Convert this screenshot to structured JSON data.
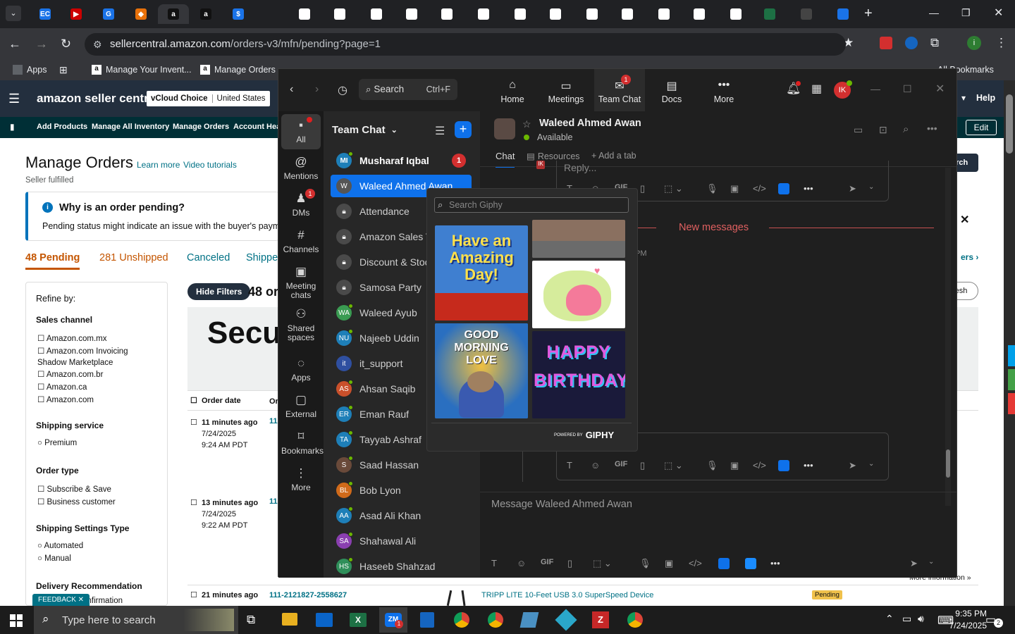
{
  "browser": {
    "url_host": "sellercentral.amazon.com",
    "url_path": "/orders-v3/mfn/pending?page=1",
    "bookmarks": [
      "Apps",
      "Manage Your Invent...",
      "Manage Orders",
      "All Bookmarks"
    ],
    "tabs": [
      {
        "icon": "EC",
        "color": "#1a73e8"
      },
      {
        "icon": "▶",
        "color": "#c00"
      },
      {
        "icon": "G",
        "color": "#1a73e8"
      },
      {
        "icon": "◆",
        "color": "#e8710a"
      },
      {
        "icon": "a",
        "color": "#111"
      },
      {
        "icon": "a",
        "color": "#111"
      },
      {
        "icon": "$",
        "color": "#1a73e8"
      }
    ]
  },
  "amazon": {
    "logo": "amazon seller central",
    "store_badge": "vCloud Choice",
    "marketplace": "United States",
    "help": "Help",
    "edit": "Edit",
    "nav": [
      "Add Products",
      "Manage All Inventory",
      "Manage Orders",
      "Account Heal"
    ],
    "page_title": "Manage Orders",
    "learn_more": "Learn more",
    "video_tutorials": "Video tutorials",
    "seller_fulfilled": "Seller fulfilled",
    "banner_title": "Why is an order pending?",
    "banner_text": "Pending status might indicate an issue with the buyer's payment m",
    "tabs": [
      "48 Pending",
      "281 Unshipped",
      "Canceled",
      "Shippe"
    ],
    "refine_by": "Refine by:",
    "sales_channel": "Sales channel",
    "channels": [
      "Amazon.com.mx",
      "Amazon.com Invoicing Shadow Marketplace",
      "Amazon.com.br",
      "Amazon.ca",
      "Amazon.com"
    ],
    "shipping_service": "Shipping service",
    "premium": "Premium",
    "order_type": "Order type",
    "order_types": [
      "Subscribe & Save",
      "Business customer"
    ],
    "shipping_settings": "Shipping Settings Type",
    "settings_types": [
      "Automated",
      "Manual"
    ],
    "delivery_rec": "Delivery Recommendation",
    "signature": "nature Confirmation",
    "hide_filters": "Hide Filters",
    "orders_count": "48 or",
    "promo_text": "Secu (OTD",
    "col_order_date": "Order date",
    "col_or": "Or",
    "orders": [
      {
        "age": "11 minutes ago",
        "date": "7/24/2025",
        "time": "9:24 AM PDT",
        "id": "11"
      },
      {
        "age": "13 minutes ago",
        "date": "7/24/2025",
        "time": "9:22 AM PDT",
        "id": "11"
      },
      {
        "age": "21 minutes ago",
        "date": "",
        "time": "",
        "id": "111-2121827-2558627"
      }
    ],
    "product_title": "TRIPP LITE 10-Feet USB 3.0 SuperSpeed Device",
    "pending_badge": "Pending",
    "more_information": "More information »",
    "search_btn": "arch",
    "refresh": "resh",
    "orders_link": "ers ›",
    "feedback": "FEEDBACK"
  },
  "teams": {
    "search": "Search",
    "search_shortcut": "Ctrl+F",
    "top_nav": [
      {
        "label": "Home",
        "icon": "⌂"
      },
      {
        "label": "Meetings",
        "icon": "▭"
      },
      {
        "label": "Team Chat",
        "icon": "✉",
        "badge": "1"
      },
      {
        "label": "Docs",
        "icon": "▤"
      },
      {
        "label": "More",
        "icon": "•••"
      }
    ],
    "user_initials": "IK",
    "rail": [
      {
        "label": "All",
        "icon": "▪"
      },
      {
        "label": "Mentions",
        "icon": "@"
      },
      {
        "label": "DMs",
        "icon": "♟",
        "badge": "1"
      },
      {
        "label": "Channels",
        "icon": "#"
      },
      {
        "label": "Meeting chats",
        "icon": "▣"
      },
      {
        "label": "Shared spaces",
        "icon": "⚇"
      },
      {
        "label": "Apps",
        "icon": "◌"
      },
      {
        "label": "External",
        "icon": "▢"
      },
      {
        "label": "Bookmarks",
        "icon": "⌑"
      },
      {
        "label": "More",
        "icon": "⋮"
      }
    ],
    "list_title": "Team Chat",
    "chats": [
      {
        "name": "Musharaf Iqbal",
        "initials": "MI",
        "color": "#1e7fb8",
        "badge": "1",
        "bold": true,
        "online": true
      },
      {
        "name": "Waleed Ahmed Awan",
        "initials": "W",
        "color": "#555",
        "selected": true
      },
      {
        "name": "Attendance",
        "lock": true
      },
      {
        "name": "Amazon Sales T",
        "lock": true
      },
      {
        "name": "Discount & Stoc",
        "lock": true
      },
      {
        "name": "Samosa Party",
        "lock": true
      },
      {
        "name": "Waleed Ayub",
        "initials": "WA",
        "color": "#3a9b52",
        "online": true
      },
      {
        "name": "Najeeb Uddin",
        "initials": "NU",
        "color": "#1e7fb8",
        "online": true
      },
      {
        "name": "it_support",
        "initials": "it",
        "color": "#2f4fa0"
      },
      {
        "name": "Ahsan Saqib",
        "initials": "AS",
        "color": "#c9502b",
        "online": true
      },
      {
        "name": "Eman Rauf",
        "initials": "ER",
        "color": "#1e7fb8",
        "online": true
      },
      {
        "name": "Tayyab Ashraf",
        "initials": "TA",
        "color": "#1e7fb8",
        "online": true
      },
      {
        "name": "Saad Hassan",
        "initials": "S",
        "color": "#6a4a3a",
        "online": true
      },
      {
        "name": "Bob Lyon",
        "initials": "BL",
        "color": "#d06a1a",
        "online": true
      },
      {
        "name": "Asad Ali Khan",
        "initials": "AA",
        "color": "#1e7fb8",
        "online": true
      },
      {
        "name": "Shahawal Ali",
        "initials": "SA",
        "color": "#8a3fb0",
        "online": true
      },
      {
        "name": "Haseeb Shahzad",
        "initials": "HS",
        "color": "#2f8f5a",
        "online": true
      }
    ],
    "contact_name": "Waleed Ahmed Awan",
    "contact_status": "Available",
    "tab_chat": "Chat",
    "tab_resources": "Resources",
    "add_tab": "Add a tab",
    "reply_placeholder": "Reply...",
    "new_messages": "New messages",
    "time_fragment": "PM",
    "message_placeholder": "Message Waleed Ahmed Awan",
    "giphy_placeholder": "Search Giphy",
    "giphy_powered": "POWERED BY",
    "giphy_brand": "GIPHY",
    "gifs": [
      {
        "text": "Have an Amazing Day!",
        "bg": "#3f7fd0"
      },
      {
        "text": "",
        "bg": "#8a7060"
      },
      {
        "text": "",
        "bg": "#d8d8c8"
      },
      {
        "text": "GOOD MORNING LOVE",
        "bg": "#2a6fc0"
      },
      {
        "text": "HAPPY BIRTHDAY",
        "bg": "#1a1a3a"
      }
    ],
    "composer_gif": "GIF"
  },
  "taskbar": {
    "search_placeholder": "Type here to search",
    "time": "9:35 PM",
    "date": "7/24/2025",
    "notifications": "2",
    "zoom_badge": "1"
  }
}
